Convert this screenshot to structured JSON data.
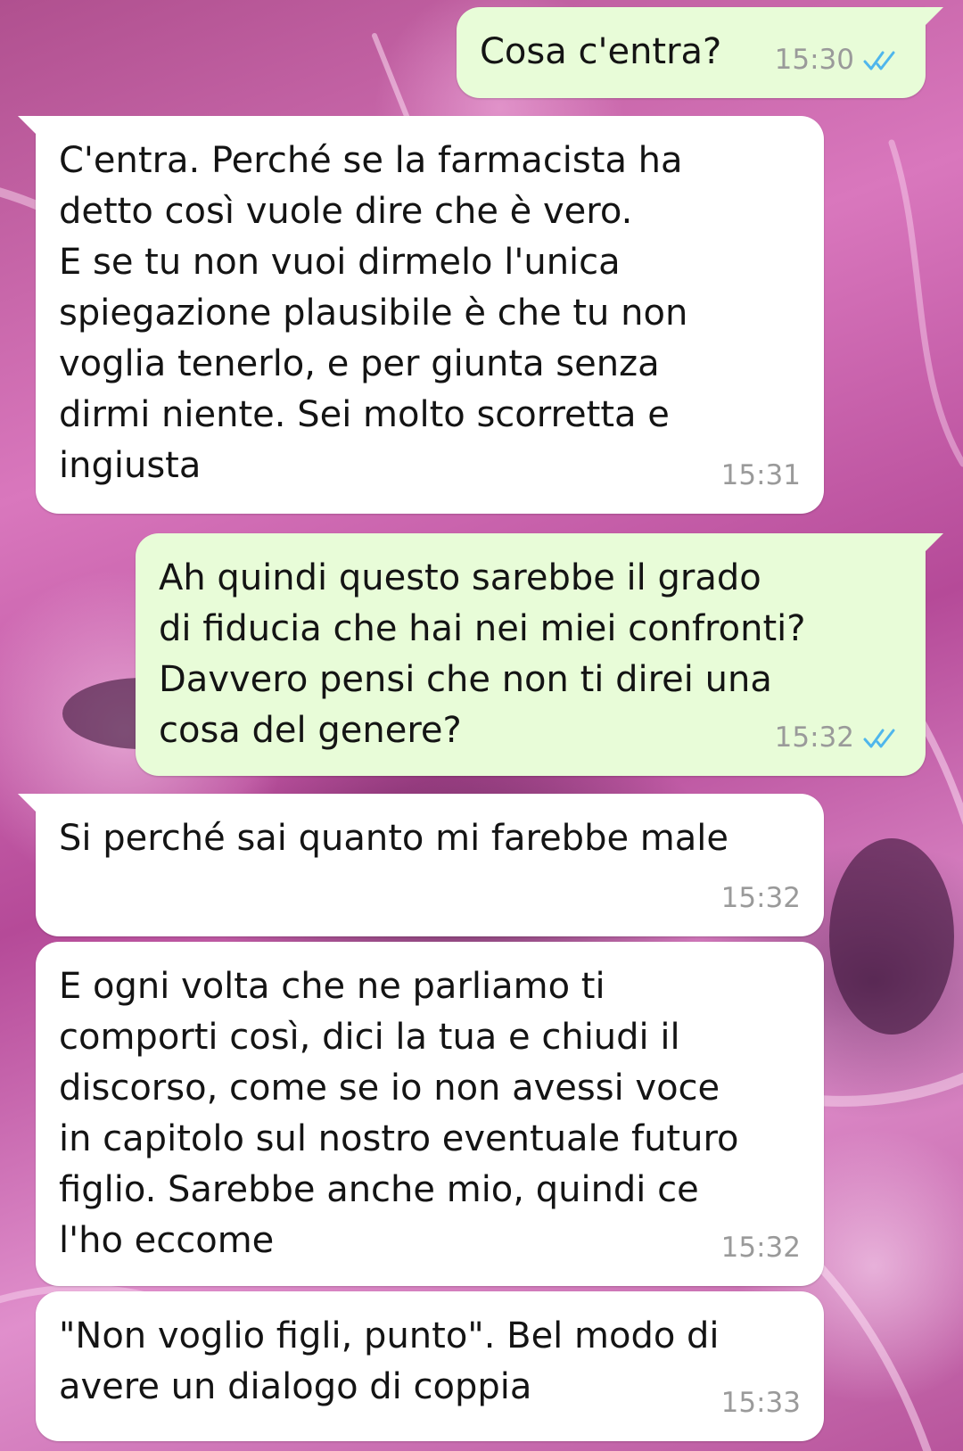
{
  "messages": [
    {
      "direction": "outgoing",
      "text": "Cosa c'entra?",
      "time": "15:30",
      "status": "read",
      "status_icon": "double-check-icon"
    },
    {
      "direction": "incoming",
      "text": "C'entra. Perché se la farmacista ha\ndetto così vuole dire che è vero.\nE se tu non vuoi dirmelo l'unica\nspiegazione plausibile è che tu non\nvoglia tenerlo, e per giunta senza\ndirmi niente. Sei molto scorretta e\ningiusta",
      "time": "15:31"
    },
    {
      "direction": "outgoing",
      "text": "Ah quindi questo sarebbe il grado\ndi fiducia che hai nei miei confronti?\nDavvero pensi che non ti direi una\ncosa del genere?",
      "time": "15:32",
      "status": "read",
      "status_icon": "double-check-icon"
    },
    {
      "direction": "incoming",
      "text": "Si perché sai quanto mi farebbe male",
      "time": "15:32"
    },
    {
      "direction": "incoming",
      "text": "E ogni volta che ne parliamo ti\ncomporti così, dici la tua e chiudi il\ndiscorso, come se io non avessi voce\nin capitolo sul nostro eventuale futuro\nfiglio. Sarebbe anche mio, quindi ce\nl'ho eccome",
      "time": "15:32"
    },
    {
      "direction": "incoming",
      "text": "\"Non voglio figli, punto\". Bel modo di\navere un dialogo di coppia",
      "time": "15:33"
    }
  ],
  "colors": {
    "incoming_bubble": "#ffffff",
    "outgoing_bubble": "#e8fcd8",
    "read_tick": "#4fb6ec",
    "timestamp": "#9a9a9a",
    "wallpaper": "#c062a6"
  }
}
